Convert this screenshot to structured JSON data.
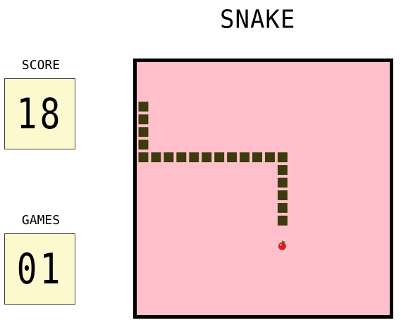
{
  "title": "SNAKE",
  "score": {
    "label": "SCORE",
    "value": "18"
  },
  "games": {
    "label": "GAMES",
    "value": "01"
  },
  "board": {
    "columns": 20,
    "rows": 20,
    "snake": [
      [
        0,
        3
      ],
      [
        0,
        4
      ],
      [
        0,
        5
      ],
      [
        0,
        6
      ],
      [
        0,
        7
      ],
      [
        1,
        7
      ],
      [
        2,
        7
      ],
      [
        3,
        7
      ],
      [
        4,
        7
      ],
      [
        5,
        7
      ],
      [
        6,
        7
      ],
      [
        7,
        7
      ],
      [
        8,
        7
      ],
      [
        9,
        7
      ],
      [
        10,
        7
      ],
      [
        11,
        7
      ],
      [
        11,
        8
      ],
      [
        11,
        9
      ],
      [
        11,
        10
      ],
      [
        11,
        11
      ],
      [
        11,
        12
      ]
    ],
    "food": [
      11,
      14
    ]
  },
  "colors": {
    "board_background": "#ffc0cb",
    "board_border": "#000000",
    "snake": "#3d3a0e",
    "lcd_background": "#fdf9cf",
    "apple": "#d81e1e",
    "apple_leaf": "#2e8b2e"
  },
  "icons": {
    "food": "apple-icon"
  }
}
